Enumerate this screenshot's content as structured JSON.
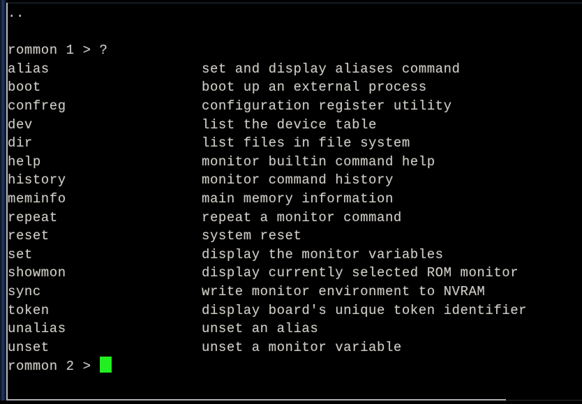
{
  "terminal": {
    "window_kind": "serial-console",
    "background_color": "#000000",
    "text_color": "#cfccc6",
    "cursor_color": "#22ee22",
    "gutter_color": "#243a68",
    "border_color": "#b9bcc0",
    "scrollback_indicator": "..",
    "lines": [
      {
        "type": "text",
        "text": ".."
      },
      {
        "type": "blank",
        "text": ""
      },
      {
        "type": "prompt",
        "text": "rommon 1 > ?"
      },
      {
        "type": "entry",
        "command": "alias",
        "description": "set and display aliases command"
      },
      {
        "type": "entry",
        "command": "boot",
        "description": "boot up an external process"
      },
      {
        "type": "entry",
        "command": "confreg",
        "description": "configuration register utility"
      },
      {
        "type": "entry",
        "command": "dev",
        "description": "list the device table"
      },
      {
        "type": "entry",
        "command": "dir",
        "description": "list files in file system"
      },
      {
        "type": "entry",
        "command": "help",
        "description": "monitor builtin command help"
      },
      {
        "type": "entry",
        "command": "history",
        "description": "monitor command history"
      },
      {
        "type": "entry",
        "command": "meminfo",
        "description": "main memory information"
      },
      {
        "type": "entry",
        "command": "repeat",
        "description": "repeat a monitor command"
      },
      {
        "type": "entry",
        "command": "reset",
        "description": "system reset"
      },
      {
        "type": "entry",
        "command": "set",
        "description": "display the monitor variables"
      },
      {
        "type": "entry",
        "command": "showmon",
        "description": "display currently selected ROM monitor"
      },
      {
        "type": "entry",
        "command": "sync",
        "description": "write monitor environment to NVRAM"
      },
      {
        "type": "entry",
        "command": "token",
        "description": "display board's unique token identifier"
      },
      {
        "type": "entry",
        "command": "unalias",
        "description": "unset an alias"
      },
      {
        "type": "entry",
        "command": "unset",
        "description": "unset a monitor variable"
      },
      {
        "type": "prompt_active",
        "text": "rommon 2 > ",
        "input": ""
      }
    ]
  }
}
